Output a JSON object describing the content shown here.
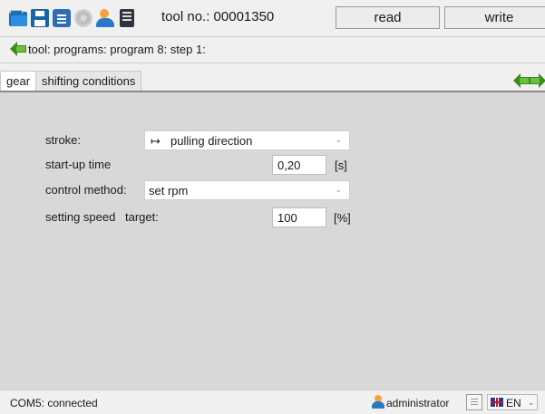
{
  "toolbar": {
    "icons": [
      "open-folder-icon",
      "save-icon",
      "document-icon",
      "settings-gear-icon",
      "users-icon",
      "tool-device-icon"
    ],
    "tool_no": "tool no.: 00001350",
    "read_label": "read",
    "write_label": "write"
  },
  "breadcrumb": {
    "text": "tool: programs: program 8: step 1:"
  },
  "tabs": [
    {
      "label": "gear",
      "active": true
    },
    {
      "label": "shifting conditions",
      "active": false
    }
  ],
  "form": {
    "stroke": {
      "label": "stroke:",
      "value": "pulling direction",
      "icon": "arrow-to-right-icon"
    },
    "startup": {
      "label": "start-up time",
      "value": "0,20",
      "unit": "[s]"
    },
    "control": {
      "label": "control method:",
      "value": "set rpm"
    },
    "speed": {
      "label": "setting speed",
      "sublabel": "target:",
      "value": "100",
      "unit": "[%]"
    }
  },
  "status": {
    "connection": "COM5: connected",
    "user": "administrator",
    "language": "EN"
  },
  "colors": {
    "accent": "#2a78c8",
    "nav_arrow": "#6cbf3a",
    "panel_bg": "#d8d8d8"
  }
}
